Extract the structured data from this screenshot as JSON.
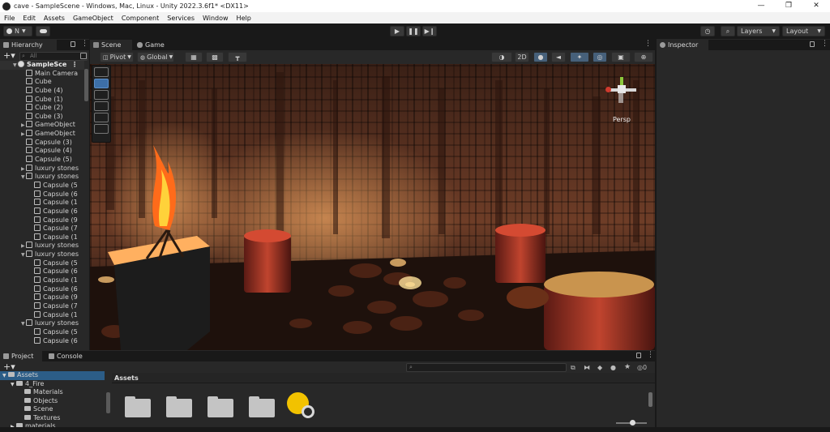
{
  "window": {
    "title": "cave - SampleScene - Windows, Mac, Linux - Unity 2022.3.6f1* <DX11>",
    "controls": [
      "—",
      "❐",
      "✕"
    ]
  },
  "menu": [
    "File",
    "Edit",
    "Assets",
    "GameObject",
    "Component",
    "Services",
    "Window",
    "Help"
  ],
  "toolbar": {
    "account_label": "N",
    "layers_label": "Layers",
    "layout_label": "Layout"
  },
  "hierarchy": {
    "tab_label": "Hierarchy",
    "search_placeholder": "All",
    "items": [
      {
        "label": "SampleScene",
        "display": "SampleSce",
        "depth": 0,
        "expanded": true,
        "scene": true
      },
      {
        "label": "Main Camera",
        "display": "Main Camera",
        "depth": 1
      },
      {
        "label": "Cube",
        "display": "Cube",
        "depth": 1
      },
      {
        "label": "Cube (4)",
        "display": "Cube (4)",
        "depth": 1
      },
      {
        "label": "Cube (1)",
        "display": "Cube (1)",
        "depth": 1
      },
      {
        "label": "Cube (2)",
        "display": "Cube (2)",
        "depth": 1
      },
      {
        "label": "Cube (3)",
        "display": "Cube (3)",
        "depth": 1
      },
      {
        "label": "GameObject",
        "display": "GameObject",
        "depth": 1,
        "expandable": true
      },
      {
        "label": "GameObject",
        "display": "GameObject",
        "depth": 1,
        "expandable": true
      },
      {
        "label": "Capsule (3)",
        "display": "Capsule (3)",
        "depth": 1
      },
      {
        "label": "Capsule (4)",
        "display": "Capsule (4)",
        "depth": 1
      },
      {
        "label": "Capsule (5)",
        "display": "Capsule (5)",
        "depth": 1
      },
      {
        "label": "luxury stones",
        "display": "luxury stones",
        "depth": 1,
        "expandable": true
      },
      {
        "label": "luxury stones",
        "display": "luxury stones",
        "depth": 1,
        "expanded": true
      },
      {
        "label": "Capsule (5",
        "display": "Capsule (5",
        "depth": 2
      },
      {
        "label": "Capsule (6",
        "display": "Capsule (6",
        "depth": 2
      },
      {
        "label": "Capsule (1",
        "display": "Capsule (1",
        "depth": 2
      },
      {
        "label": "Capsule (6",
        "display": "Capsule (6",
        "depth": 2
      },
      {
        "label": "Capsule (9",
        "display": "Capsule (9",
        "depth": 2
      },
      {
        "label": "Capsule (7",
        "display": "Capsule (7",
        "depth": 2
      },
      {
        "label": "Capsule (1",
        "display": "Capsule (1",
        "depth": 2
      },
      {
        "label": "luxury stones",
        "display": "luxury stones",
        "depth": 1,
        "expandable": true
      },
      {
        "label": "luxury stones",
        "display": "luxury stones",
        "depth": 1,
        "expanded": true
      },
      {
        "label": "Capsule (5",
        "display": "Capsule (5",
        "depth": 2
      },
      {
        "label": "Capsule (6",
        "display": "Capsule (6",
        "depth": 2
      },
      {
        "label": "Capsule (1",
        "display": "Capsule (1",
        "depth": 2
      },
      {
        "label": "Capsule (6",
        "display": "Capsule (6",
        "depth": 2
      },
      {
        "label": "Capsule (9",
        "display": "Capsule (9",
        "depth": 2
      },
      {
        "label": "Capsule (7",
        "display": "Capsule (7",
        "depth": 2
      },
      {
        "label": "Capsule (1",
        "display": "Capsule (1",
        "depth": 2
      },
      {
        "label": "luxury stones",
        "display": "luxury stones",
        "depth": 1,
        "expanded": true
      },
      {
        "label": "Capsule (5",
        "display": "Capsule (5",
        "depth": 2
      },
      {
        "label": "Capsule (6",
        "display": "Capsule (6",
        "depth": 2
      }
    ]
  },
  "scene": {
    "tabs": [
      "Scene",
      "Game"
    ],
    "pivot_label": "Pivot",
    "global_label": "Global",
    "mode_2d_label": "2D",
    "projection_label": "Persp"
  },
  "inspector": {
    "tab_label": "Inspector"
  },
  "project": {
    "tabs": [
      "Project",
      "Console"
    ],
    "breadcrumb": "Assets",
    "hidden_count": "0",
    "tree": [
      {
        "label": "Assets",
        "depth": 0,
        "selected": true
      },
      {
        "label": "4_Fire",
        "depth": 1
      },
      {
        "label": "Materials",
        "depth": 2
      },
      {
        "label": "Objects",
        "depth": 2
      },
      {
        "label": "Scene",
        "depth": 2
      },
      {
        "label": "Textures",
        "depth": 2
      },
      {
        "label": "materials",
        "depth": 1
      }
    ]
  }
}
